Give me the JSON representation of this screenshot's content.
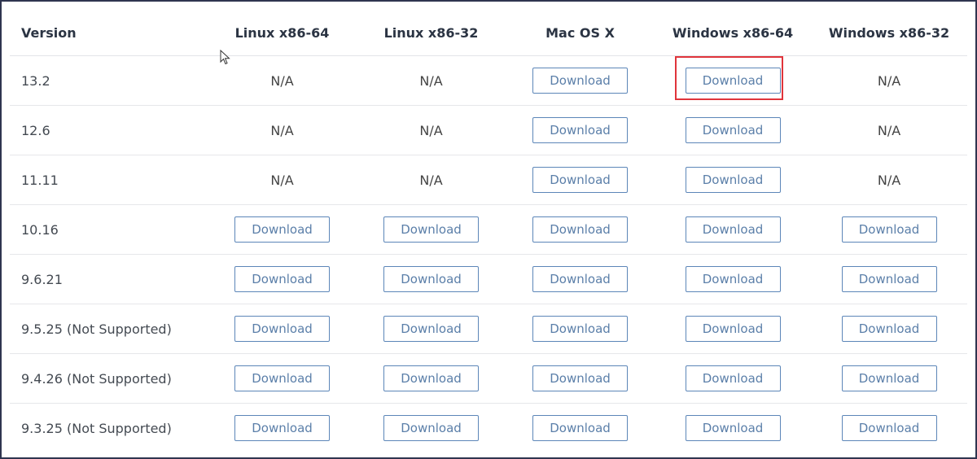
{
  "table": {
    "headers": {
      "version": "Version",
      "linux64": "Linux x86-64",
      "linux32": "Linux x86-32",
      "mac": "Mac OS X",
      "win64": "Windows x86-64",
      "win32": "Windows x86-32"
    },
    "download_label": "Download",
    "na_label": "N/A",
    "rows": [
      {
        "version": "13.2",
        "cells": [
          "N/A",
          "N/A",
          "Download",
          "Download",
          "N/A"
        ]
      },
      {
        "version": "12.6",
        "cells": [
          "N/A",
          "N/A",
          "Download",
          "Download",
          "N/A"
        ]
      },
      {
        "version": "11.11",
        "cells": [
          "N/A",
          "N/A",
          "Download",
          "Download",
          "N/A"
        ]
      },
      {
        "version": "10.16",
        "cells": [
          "Download",
          "Download",
          "Download",
          "Download",
          "Download"
        ]
      },
      {
        "version": "9.6.21",
        "cells": [
          "Download",
          "Download",
          "Download",
          "Download",
          "Download"
        ]
      },
      {
        "version": "9.5.25 (Not Supported)",
        "cells": [
          "Download",
          "Download",
          "Download",
          "Download",
          "Download"
        ]
      },
      {
        "version": "9.4.26 (Not Supported)",
        "cells": [
          "Download",
          "Download",
          "Download",
          "Download",
          "Download"
        ]
      },
      {
        "version": "9.3.25 (Not Supported)",
        "cells": [
          "Download",
          "Download",
          "Download",
          "Download",
          "Download"
        ]
      }
    ]
  },
  "colors": {
    "button_border": "#5c86b8",
    "button_text": "#5b7fa9",
    "highlight": "#e0343b",
    "frame": "#2f3550"
  },
  "annotations": {
    "highlighted_cell": {
      "row": "13.2",
      "column": "Windows x86-64"
    }
  }
}
